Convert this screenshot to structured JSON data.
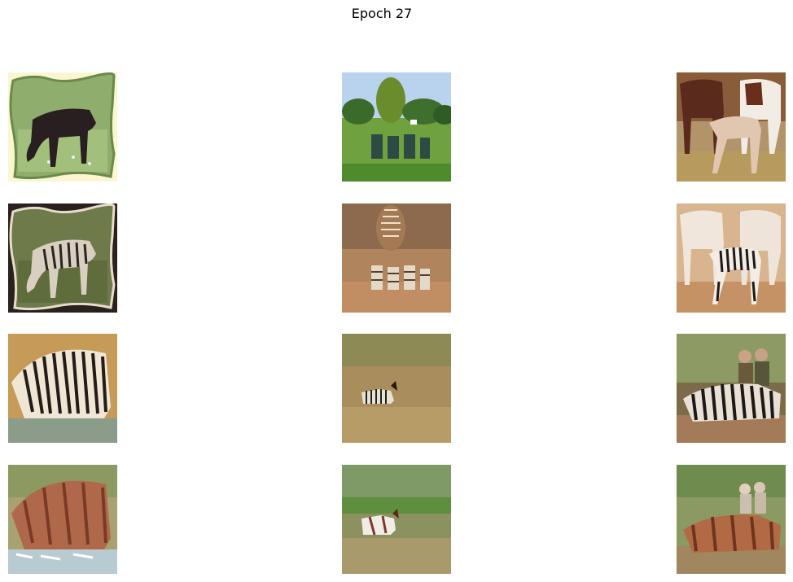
{
  "figure": {
    "title": "Epoch 27"
  },
  "panels": [
    {
      "row": 0,
      "col": 0,
      "subject": "dark-horse-grazing-wavy-frame"
    },
    {
      "row": 0,
      "col": 1,
      "subject": "garden-chairs-on-lawn-with-trees"
    },
    {
      "row": 0,
      "col": 2,
      "subject": "horses-with-foal"
    },
    {
      "row": 1,
      "col": 0,
      "subject": "zebra-grazing-wavy-frame"
    },
    {
      "row": 1,
      "col": 1,
      "subject": "zebra-textured-garden-scene"
    },
    {
      "row": 1,
      "col": 2,
      "subject": "zebra-striped-foal"
    },
    {
      "row": 2,
      "col": 0,
      "subject": "zebras-drinking-at-water"
    },
    {
      "row": 2,
      "col": 1,
      "subject": "lone-zebra-in-tall-grass"
    },
    {
      "row": 2,
      "col": 2,
      "subject": "hunters-with-downed-zebra"
    },
    {
      "row": 3,
      "col": 0,
      "subject": "horse-textured-zebras-drinking"
    },
    {
      "row": 3,
      "col": 1,
      "subject": "horse-textured-animal-in-grass"
    },
    {
      "row": 3,
      "col": 2,
      "subject": "horse-textured-downed-animal"
    }
  ]
}
